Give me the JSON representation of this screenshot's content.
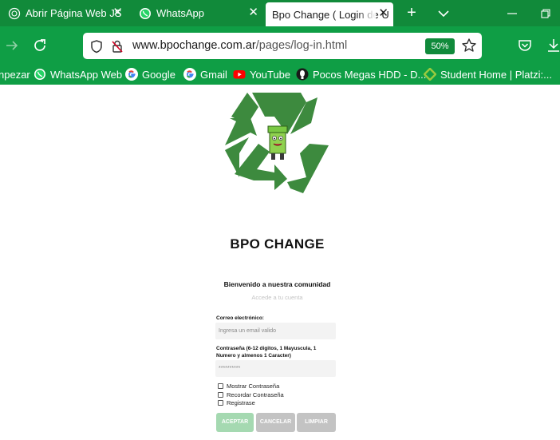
{
  "browser": {
    "tabs": [
      {
        "label": "Abrir Página Web JS",
        "icon": "chatgpt-icon",
        "active": false
      },
      {
        "label": "WhatsApp",
        "icon": "whatsapp-icon",
        "active": false
      },
      {
        "label": "Bpo Change ( Login de U",
        "icon": "none",
        "active": true
      }
    ],
    "address": {
      "domain": "www.bpochange.com.ar",
      "path": "/pages/log-in.html",
      "zoom": "50%"
    },
    "bookmarks": [
      {
        "label": "npezar",
        "icon": "none"
      },
      {
        "label": "WhatsApp Web",
        "icon": "whatsapp-icon"
      },
      {
        "label": "Google",
        "icon": "google-icon"
      },
      {
        "label": "Gmail",
        "icon": "google-icon"
      },
      {
        "label": "YouTube",
        "icon": "youtube-icon"
      },
      {
        "label": "Pocos Megas HDD - D...",
        "icon": "pocosmegas-icon"
      },
      {
        "label": "Student Home | Platzi:...",
        "icon": "platzi-icon"
      }
    ],
    "colors": {
      "tabbar": "#118a3a",
      "toolbar": "#0f9e45"
    }
  },
  "page": {
    "title": "BPO CHANGE",
    "welcome": "Bienvenido a nuestra comunidad",
    "subtitle": "Accede a tu cuenta",
    "email_label": "Correo electrónico:",
    "email_placeholder": "Ingresa un email valido",
    "password_label": "Contraseña (6-12 digitos, 1 Mayuscula, 1 Numero y almenos 1 Caracter)",
    "password_value": "**********",
    "checkboxes": [
      {
        "label": "Mostrar Contraseña",
        "checked": false
      },
      {
        "label": "Recordar Contraseña",
        "checked": false
      },
      {
        "label": "Registrase",
        "checked": false
      }
    ],
    "buttons": {
      "accept": "ACEPTAR",
      "cancel": "CANCELAR",
      "clear": "LIMPIAR"
    },
    "colors": {
      "logo_green": "#3d8a3e",
      "accept_button": "#a5d9b1",
      "disabled_button": "#c3c3c3"
    }
  }
}
